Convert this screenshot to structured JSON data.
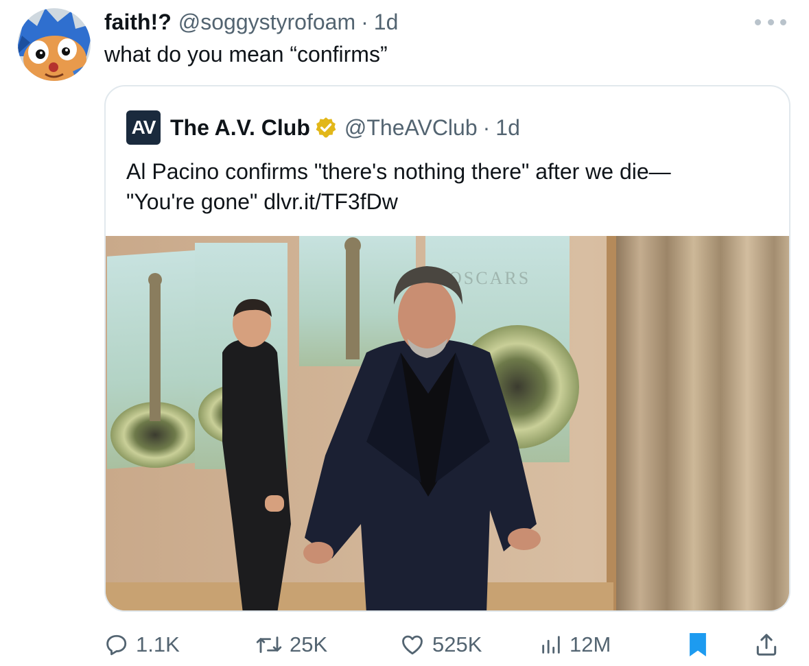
{
  "reply": {
    "display_name": "faith!?",
    "handle": "@soggystyrofoam",
    "separator": "·",
    "time": "1d",
    "text": "what do you mean “confirms”",
    "avatar_icon": "blue-hedgehog-avatar-icon",
    "more_icon": "more-dots-icon"
  },
  "quoted": {
    "logo_text": "AV",
    "display_name": "The A.V. Club",
    "verified_icon": "gold-verified-badge-icon",
    "handle": "@TheAVClub",
    "separator": "·",
    "time": "1d",
    "text_line1": "Al Pacino confirms \"there's nothing there\" after we die—",
    "text_line2": "\"You're gone\" dlvr.it/TF3fDw",
    "image_sign_text": "OSCARS"
  },
  "actions": {
    "reply_count": "1.1K",
    "retweet_count": "25K",
    "like_count": "525K",
    "views_count": "12M",
    "icons": [
      "reply-icon",
      "retweet-icon",
      "heart-icon",
      "views-icon",
      "bookmark-icon",
      "share-icon"
    ]
  },
  "colors": {
    "text_primary": "#0f1419",
    "text_secondary": "#536471",
    "border": "#e1e8ed",
    "bookmark_active": "#1d9bf0",
    "verified_gold": "#e2b719"
  }
}
